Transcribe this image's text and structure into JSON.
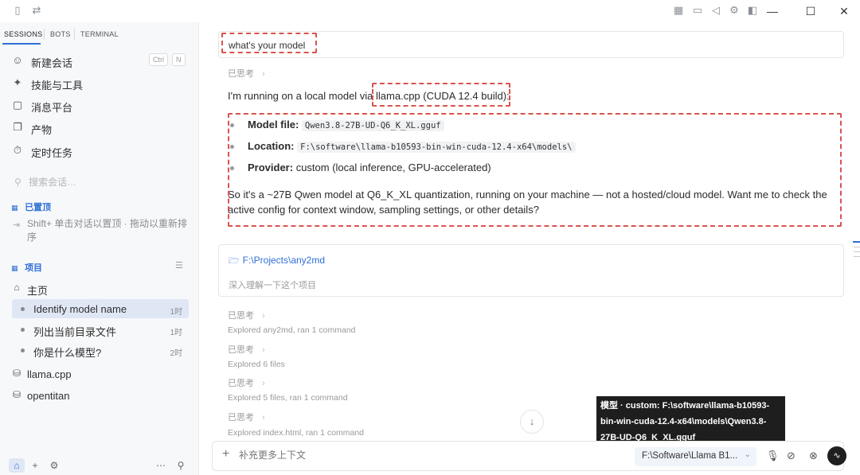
{
  "titlebar": {
    "icons": [
      "sidebar-toggle-icon",
      "swap-icon",
      "layout-icon",
      "chat-icon",
      "volume-icon",
      "gear-icon",
      "panel-icon"
    ],
    "window_controls": {
      "minimize": "—",
      "maximize": "☐",
      "close": "✕"
    }
  },
  "sidebar": {
    "tabs": [
      "SESSIONS",
      "BOTS",
      "TERMINAL"
    ],
    "nav": [
      {
        "label": "新建会话",
        "icon": "new-chat-icon",
        "shortcut": [
          "Ctrl",
          "N"
        ]
      },
      {
        "label": "技能与工具",
        "icon": "skills-icon"
      },
      {
        "label": "消息平台",
        "icon": "message-icon"
      },
      {
        "label": "产物",
        "icon": "artifact-icon"
      },
      {
        "label": "定时任务",
        "icon": "timer-icon"
      }
    ],
    "search_placeholder": "搜索会话…",
    "pinned_title": "已置顶",
    "pinned_hint": "Shift+ 单击对话以置顶 · 拖动以重新排序",
    "projects_title": "项目",
    "home_label": "主页",
    "sessions": [
      {
        "label": "Identify model name",
        "time": "1时",
        "active": true
      },
      {
        "label": "列出当前目录文件",
        "time": "1时",
        "active": false
      },
      {
        "label": "你是什么模型?",
        "time": "2时",
        "active": false
      }
    ],
    "projects": [
      "llama.cpp",
      "opentitan"
    ],
    "bottom_icons": [
      "home-icon",
      "plus-icon",
      "settings-small-icon",
      "more-icon",
      "pin-icon"
    ]
  },
  "chat": {
    "user_message": "what's your model",
    "thought_label": "已思考",
    "answer_lead": "I'm running on a local model via llama.cpp (CUDA 12.4 build):",
    "bullets": [
      {
        "label": "Model file:",
        "code": "Qwen3.8-27B-UD-Q6_K_XL.gguf"
      },
      {
        "label": "Location:",
        "code": "F:\\software\\llama-b10593-bin-win-cuda-12.4-x64\\models\\"
      },
      {
        "label": "Provider:",
        "text": "custom (local inference, GPU-accelerated)"
      }
    ],
    "summary": "So it's a ~27B Qwen model at Q6_K_XL quantization, running on your machine — not a hosted/cloud model. Want me to check the active config for context window, sampling settings, or other details?",
    "project_path": "F:\\Projects\\any2md",
    "project_prompt": "深入理解一下这个项目",
    "logs": [
      "Explored any2md, ran 1 command",
      "Explored 6 files",
      "Explored 5 files, ran 1 command",
      "Explored index.html, ran 1 command"
    ]
  },
  "tooltip": "模型 · custom: F:\\software\\llama-b10593-bin-win-cuda-12.4-x64\\models\\Qwen3.8-27B-UD-Q6_K_XL.gguf",
  "composer": {
    "placeholder": "补充更多上下文",
    "model_selected": "F:\\Software\\Llama B1...",
    "icons": [
      "mic-icon",
      "mute-icon",
      "no-hearing-icon"
    ],
    "send_icon": "send-icon"
  },
  "colors": {
    "accent": "#2f6fd6",
    "highlight_box": "#d9534f"
  }
}
